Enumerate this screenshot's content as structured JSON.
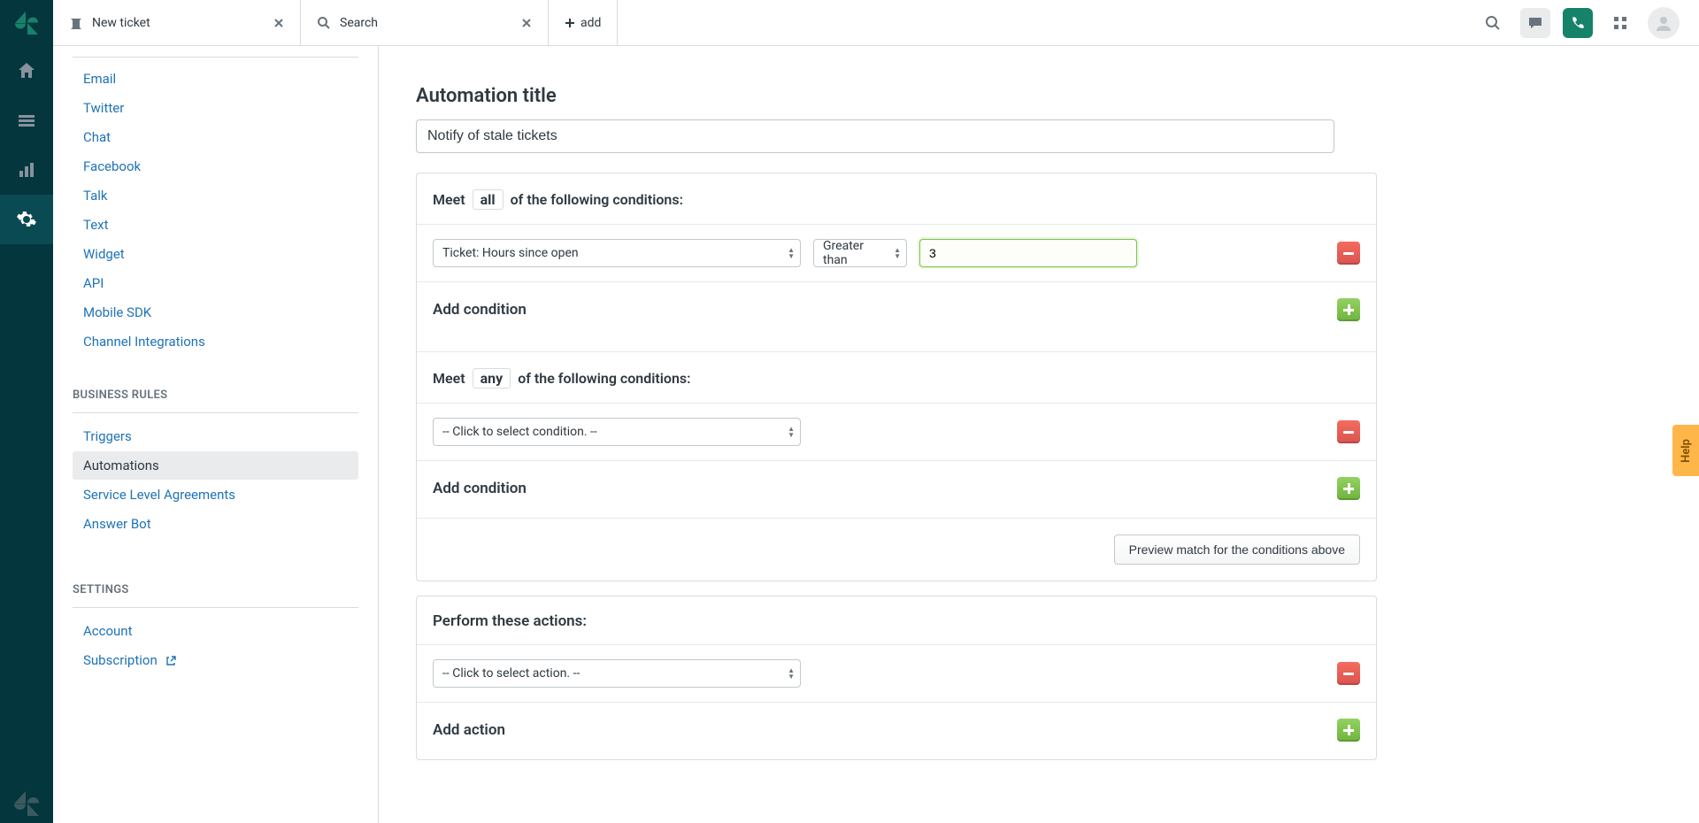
{
  "tabs": {
    "items": [
      {
        "title": "New ticket",
        "icon": "ticket"
      },
      {
        "title": "Search",
        "icon": "search"
      }
    ],
    "add_label": "add"
  },
  "sidebar": {
    "channels": [
      "Email",
      "Twitter",
      "Chat",
      "Facebook",
      "Talk",
      "Text",
      "Widget",
      "API",
      "Mobile SDK",
      "Channel Integrations"
    ],
    "business_rules_header": "BUSINESS RULES",
    "business_rules": [
      "Triggers",
      "Automations",
      "Service Level Agreements",
      "Answer Bot"
    ],
    "business_rules_active": 1,
    "settings_header": "SETTINGS",
    "settings": [
      "Account",
      "Subscription"
    ]
  },
  "main": {
    "title_label": "Automation title",
    "title_value": "Notify of stale tickets",
    "meet_prefix": "Meet",
    "meet_all_word": "all",
    "meet_any_word": "any",
    "meet_suffix": "of the following conditions:",
    "condition_all": {
      "field": "Ticket: Hours since open",
      "operator": "Greater than",
      "value": "3"
    },
    "condition_any": {
      "field": "-- Click to select condition. --"
    },
    "add_condition_label": "Add condition",
    "preview_label": "Preview match for the conditions above",
    "actions_header": "Perform these actions:",
    "action_placeholder": "-- Click to select action. --",
    "add_action_label": "Add action"
  },
  "help_label": "Help"
}
